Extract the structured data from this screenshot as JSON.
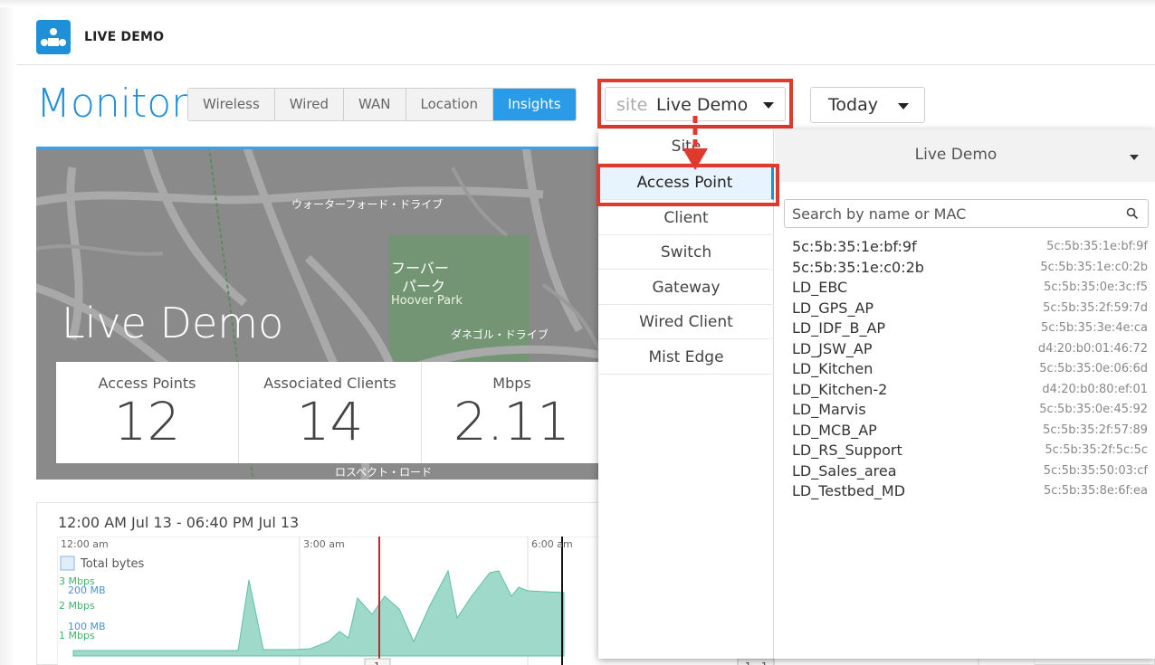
{
  "app": {
    "title": "LIVE DEMO"
  },
  "page": {
    "title": "Monitor"
  },
  "tabs": [
    {
      "label": "Wireless",
      "active": false
    },
    {
      "label": "Wired",
      "active": false
    },
    {
      "label": "WAN",
      "active": false
    },
    {
      "label": "Location",
      "active": false
    },
    {
      "label": "Insights",
      "active": true
    }
  ],
  "site_select": {
    "prefix": "site",
    "value": "Live Demo"
  },
  "date_select": {
    "value": "Today"
  },
  "hero": {
    "title": "Live Demo",
    "map_labels": [
      "ウォーターフォード・ドライブ",
      "フーバー",
      "パーク",
      "Hoover Park",
      "ダネゴル・ドライブ",
      "ロスペクト・ロード"
    ],
    "stats": [
      {
        "label": "Access Points",
        "value": "12"
      },
      {
        "label": "Associated Clients",
        "value": "14"
      },
      {
        "label": "Mbps",
        "value": "2.11"
      }
    ]
  },
  "timeline": {
    "range": "12:00 AM Jul 13 - 06:40 PM Jul 13",
    "ticks": [
      "12:00 am",
      "3:00 am",
      "6:00 am"
    ],
    "legend": "Total bytes",
    "y_mbps": [
      "3 Mbps",
      "2 Mbps",
      "1 Mbps"
    ],
    "y_mb": [
      "200 MB",
      "100 MB"
    ],
    "markers": [
      "1",
      "1",
      "1"
    ]
  },
  "dropdown": {
    "categories": [
      {
        "label": "Site",
        "selected": false
      },
      {
        "label": "Access Point",
        "selected": true
      },
      {
        "label": "Client",
        "selected": false
      },
      {
        "label": "Switch",
        "selected": false
      },
      {
        "label": "Gateway",
        "selected": false
      },
      {
        "label": "Wired Client",
        "selected": false
      },
      {
        "label": "Mist Edge",
        "selected": false
      }
    ],
    "site": "Live Demo",
    "search_placeholder": "Search by name or MAC",
    "access_points": [
      {
        "name": "5c:5b:35:1e:bf:9f",
        "mac": "5c:5b:35:1e:bf:9f"
      },
      {
        "name": "5c:5b:35:1e:c0:2b",
        "mac": "5c:5b:35:1e:c0:2b"
      },
      {
        "name": "LD_EBC",
        "mac": "5c:5b:35:0e:3c:f5"
      },
      {
        "name": "LD_GPS_AP",
        "mac": "5c:5b:35:2f:59:7d"
      },
      {
        "name": "LD_IDF_B_AP",
        "mac": "5c:5b:35:3e:4e:ca"
      },
      {
        "name": "LD_JSW_AP",
        "mac": "d4:20:b0:01:46:72"
      },
      {
        "name": "LD_Kitchen",
        "mac": "5c:5b:35:0e:06:6d"
      },
      {
        "name": "LD_Kitchen-2",
        "mac": "d4:20:b0:80:ef:01"
      },
      {
        "name": "LD_Marvis",
        "mac": "5c:5b:35:0e:45:92"
      },
      {
        "name": "LD_MCB_AP",
        "mac": "5c:5b:35:2f:57:89"
      },
      {
        "name": "LD_RS_Support",
        "mac": "5c:5b:35:2f:5c:5c"
      },
      {
        "name": "LD_Sales_area",
        "mac": "5c:5b:35:50:03:cf"
      },
      {
        "name": "LD_Testbed_MD",
        "mac": "5c:5b:35:8e:6f:ea"
      }
    ]
  },
  "colors": {
    "accent": "#1f8fd8",
    "tab_active": "#2a9be6",
    "highlight": "#e03a2f",
    "chart_fill": "#9fd9c9",
    "chart_line": "#5fbfa6"
  }
}
